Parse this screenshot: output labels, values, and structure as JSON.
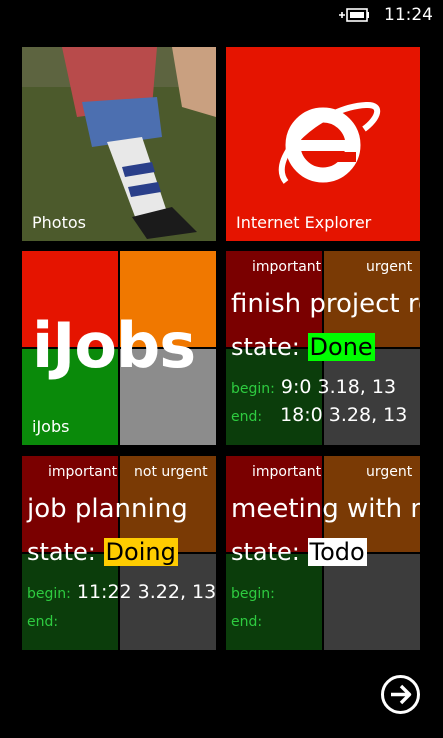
{
  "status_bar": {
    "time": "11:24",
    "battery_icon": "charging-battery-icon"
  },
  "tiles": {
    "photos": {
      "label": "Photos"
    },
    "internet_explorer": {
      "label": "Internet Explorer",
      "icon": "internet-explorer-icon"
    },
    "ijobs": {
      "big_text": "iJobs",
      "label": "iJobs"
    },
    "jobs": [
      {
        "importance": "important",
        "urgency": "urgent",
        "title": "finish project re",
        "state_label": "state:",
        "state": "Done",
        "state_color": "#00ff00",
        "begin_label": "begin:",
        "begin": "9:0 3.18, 13",
        "end_label": "end:",
        "end": "18:0 3.28, 13"
      },
      {
        "importance": "important",
        "urgency": "not urgent",
        "title": "job planning",
        "state_label": "state:",
        "state": "Doing",
        "state_color": "#ffcc00",
        "begin_label": "begin:",
        "begin": "11:22 3.22, 13",
        "end_label": "end:",
        "end": ""
      },
      {
        "importance": "important",
        "urgency": "urgent",
        "title": "meeting with m",
        "state_label": "state:",
        "state": "Todo",
        "state_color": "#ffffff",
        "begin_label": "begin:",
        "begin": "",
        "end_label": "end:",
        "end": ""
      }
    ]
  },
  "footer": {
    "next_icon": "arrow-right-circle-icon"
  },
  "colors": {
    "ie_red": "#e51400",
    "quad_red": "#e51400",
    "quad_orange": "#f07800",
    "quad_green": "#0a8a0a",
    "quad_gray": "#8c8c8c",
    "job_red": "#7a0000",
    "job_brown": "#7a3a05",
    "job_green": "#0b3d0b",
    "job_gray": "#3c3c3c"
  }
}
